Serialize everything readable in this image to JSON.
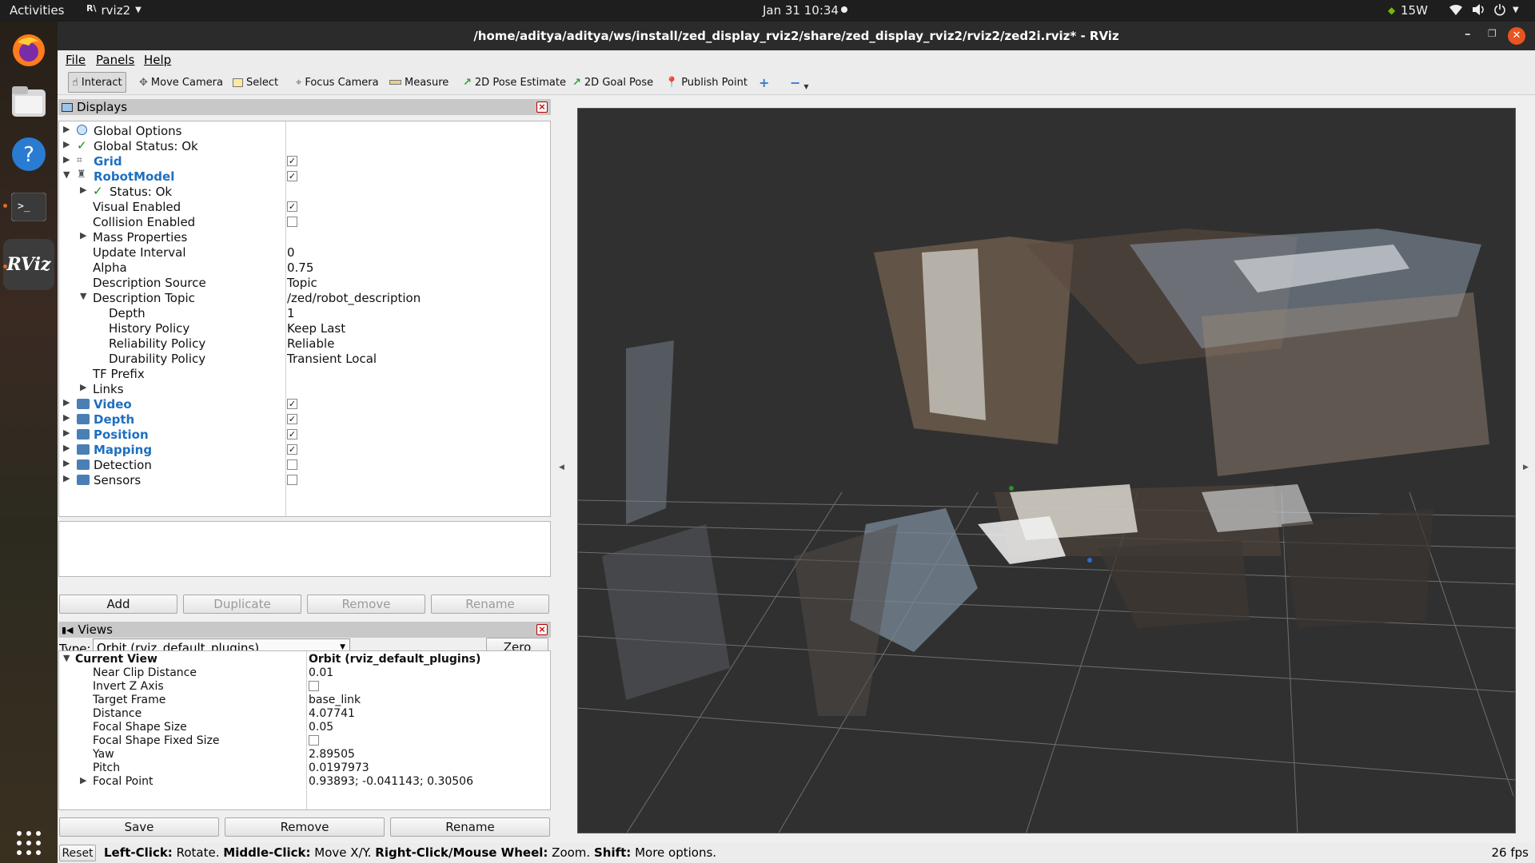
{
  "topbar": {
    "activities": "Activities",
    "app": "rviz2",
    "clock": "Jan 31  10:34",
    "power": "15W"
  },
  "dock": {
    "items": [
      "firefox-icon",
      "files-icon",
      "help-icon",
      "terminal-icon",
      "rviz-icon",
      "app-grid-icon"
    ],
    "rviz_label": "RViz"
  },
  "window": {
    "title": "/home/aditya/aditya/ws/install/zed_display_rviz2/share/zed_display_rviz2/rviz2/zed2i.rviz* - RViz"
  },
  "menu": {
    "file": "File",
    "panels": "Panels",
    "help": "Help"
  },
  "toolbar": {
    "interact": "Interact",
    "move_camera": "Move Camera",
    "select": "Select",
    "focus_camera": "Focus Camera",
    "measure": "Measure",
    "pose_estimate": "2D Pose Estimate",
    "goal_pose": "2D Goal Pose",
    "publish_point": "Publish Point"
  },
  "displays": {
    "title": "Displays",
    "global_options": "Global Options",
    "global_status": "Global Status: Ok",
    "grid": "Grid",
    "robot_model": "RobotModel",
    "status_ok": "Status: Ok",
    "visual_enabled": "Visual Enabled",
    "collision_enabled": "Collision Enabled",
    "mass_properties": "Mass Properties",
    "update_interval": "Update Interval",
    "update_interval_val": "0",
    "alpha": "Alpha",
    "alpha_val": "0.75",
    "description_source": "Description Source",
    "description_source_val": "Topic",
    "description_topic": "Description Topic",
    "description_topic_val": "/zed/robot_description",
    "depth_prop": "Depth",
    "depth_prop_val": "1",
    "history_policy": "History Policy",
    "history_policy_val": "Keep Last",
    "reliability_policy": "Reliability Policy",
    "reliability_policy_val": "Reliable",
    "durability_policy": "Durability Policy",
    "durability_policy_val": "Transient Local",
    "tf_prefix": "TF Prefix",
    "links": "Links",
    "video": "Video",
    "depth": "Depth",
    "position": "Position",
    "mapping": "Mapping",
    "detection": "Detection",
    "sensors": "Sensors",
    "add": "Add",
    "duplicate": "Duplicate",
    "remove": "Remove",
    "rename": "Rename"
  },
  "views": {
    "title": "Views",
    "type_label": "Type:",
    "type_value": "Orbit (rviz_default_plugins)",
    "zero": "Zero",
    "current_view": "Current View",
    "current_view_val": "Orbit (rviz_default_plugins)",
    "near_clip": "Near Clip Distance",
    "near_clip_val": "0.01",
    "invert_z": "Invert Z Axis",
    "target_frame": "Target Frame",
    "target_frame_val": "base_link",
    "distance": "Distance",
    "distance_val": "4.07741",
    "focal_shape_size": "Focal Shape Size",
    "focal_shape_size_val": "0.05",
    "focal_shape_fixed": "Focal Shape Fixed Size",
    "yaw": "Yaw",
    "yaw_val": "2.89505",
    "pitch": "Pitch",
    "pitch_val": "0.0197973",
    "focal_point": "Focal Point",
    "focal_point_val": "0.93893; -0.041143; 0.30506",
    "save": "Save",
    "remove": "Remove",
    "rename": "Rename"
  },
  "status": {
    "reset": "Reset",
    "left_click": "Left-Click:",
    "left_click_desc": "Rotate.",
    "middle_click": "Middle-Click:",
    "middle_click_desc": "Move X/Y.",
    "right_click": "Right-Click/Mouse Wheel:",
    "right_click_desc": "Zoom.",
    "shift": "Shift:",
    "shift_desc": "More options.",
    "fps": "26 fps"
  },
  "colors": {
    "accent": "#1e6fc0",
    "titlebar": "#2b2b2b",
    "viewport": "#303030"
  }
}
